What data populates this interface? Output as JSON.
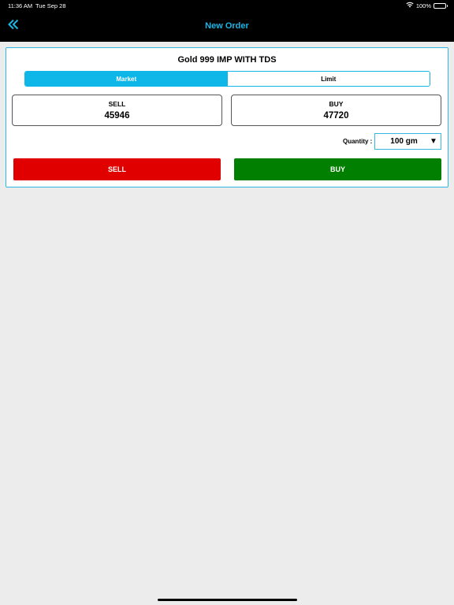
{
  "status_bar": {
    "time": "11:36 AM",
    "date": "Tue Sep 28",
    "battery": "100%"
  },
  "nav": {
    "title": "New Order"
  },
  "order": {
    "product": "Gold 999 IMP WITH TDS",
    "tabs": [
      {
        "label": "Market",
        "active": true
      },
      {
        "label": "Limit",
        "active": false
      }
    ],
    "sell": {
      "label": "SELL",
      "price": "45946"
    },
    "buy": {
      "label": "BUY",
      "price": "47720"
    },
    "quantity": {
      "label": "Quantity :",
      "value": "100 gm"
    },
    "actions": {
      "sell_label": "SELL",
      "buy_label": "BUY"
    }
  },
  "colors": {
    "accent": "#0fb6e8",
    "nav_title": "#19b6e6",
    "sell": "#e00000",
    "buy": "#007f00",
    "background": "#ececec"
  },
  "icons": {
    "back": "double-chevron-left-icon",
    "wifi": "wifi-icon",
    "battery": "battery-icon",
    "dropdown": "dropdown-triangle-icon"
  }
}
